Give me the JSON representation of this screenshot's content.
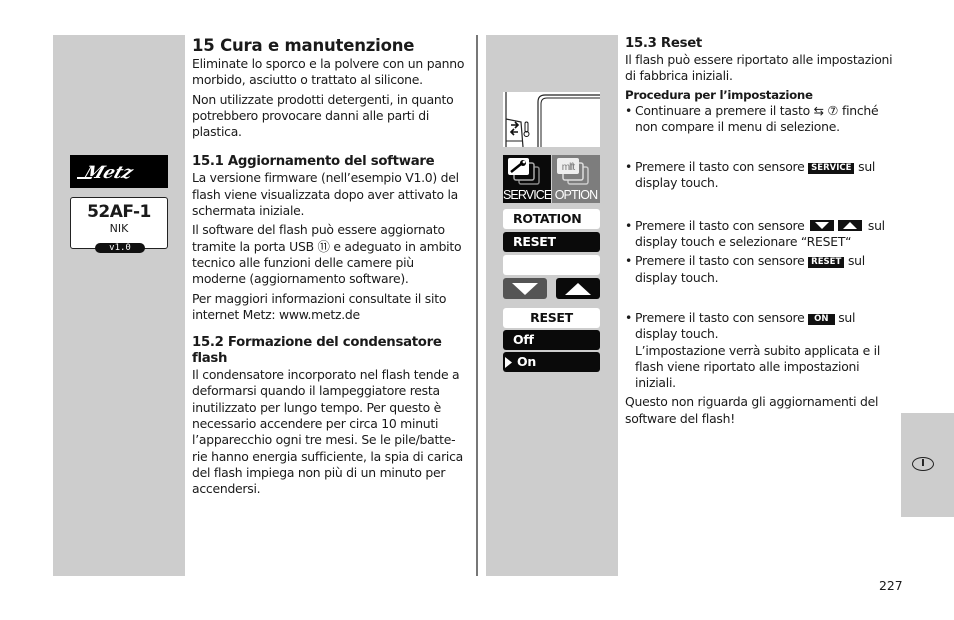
{
  "page_number": "227",
  "language_tab": "I",
  "left_column": {
    "title": "15 Cura e manutenzione",
    "intro": [
      "Eliminate lo sporco e la polvere con un panno morbido, asciutto o trattato al silicone.",
      "Non utilizzate prodotti detergenti, in quanto potrebbero provocare danni alle parti di plastica."
    ],
    "section1": {
      "heading": "15.1 Aggiornamento del software",
      "paragraphs": [
        "La versione firmware (nell’esempio V1.0) del flash viene visualizzata dopo aver attivato la schermata iniziale.",
        "Il software del flash può essere aggiornato tramite la porta USB ⑪ e adeguato in ambito tecnico alle funzioni delle camere più moderne (aggiornamento software).",
        "Per maggiori informazioni consultate il sito internet Metz: www.metz.de"
      ]
    },
    "section2": {
      "heading": "15.2 Formazione del condensatore flash",
      "paragraph": "Il condensatore incorporato nel flash tende a deformarsi quando il lampeggiatore resta inutilizzato per lungo tempo. Per questo è necessario accendere per circa 10 minuti l’apparecchio ogni tre mesi. Se le pile/batte-rie hanno energia sufficiente, la spia di carica del flash impiega non più di un minuto per accendersi."
    }
  },
  "start_screen": {
    "brand": "Metz",
    "model": "52AF-1",
    "system": "NIK",
    "version": "v1.0"
  },
  "device_menu": {
    "tabs": [
      {
        "label": "SERVICE",
        "icon": "wrench-icon",
        "active": true
      },
      {
        "label": "OPTION",
        "icon": "mlft-icon",
        "icon_text": "mlft",
        "active": false
      }
    ],
    "items": [
      "ROTATION",
      "RESET",
      ""
    ],
    "reset_dialog": {
      "title": "RESET",
      "options": [
        "Off",
        "On"
      ],
      "selected": "On"
    }
  },
  "right_column": {
    "heading": "15.3 Reset",
    "intro": "Il flash può essere riportato alle impostazioni di fabbrica iniziali.",
    "procedure_heading": "Procedura per l’impostazione",
    "steps": {
      "s1": "Continuare a premere il tasto ⇆ ⑦ finché non compare il menu di selezione.",
      "s2_pre": "Premere il tasto con sensore ",
      "s2_badge": "SERVICE",
      "s2_post": " sul display touch.",
      "s3_pre": "Premere il tasto con sensore ",
      "s3_post": " sul display touch e selezionare “RESET“",
      "s4_pre": "Premere il tasto con sensore ",
      "s4_badge": "RESET",
      "s4_post": " sul display touch.",
      "s5_pre": "Premere il tasto con sensore ",
      "s5_badge": "ON",
      "s5_post": " sul display touch.",
      "s5_note": "L’impostazione verrà subito applicata e il flash viene riportato alle impostazioni iniziali."
    },
    "footer_note": "Questo non riguarda gli aggiornamenti del software del flash!"
  }
}
